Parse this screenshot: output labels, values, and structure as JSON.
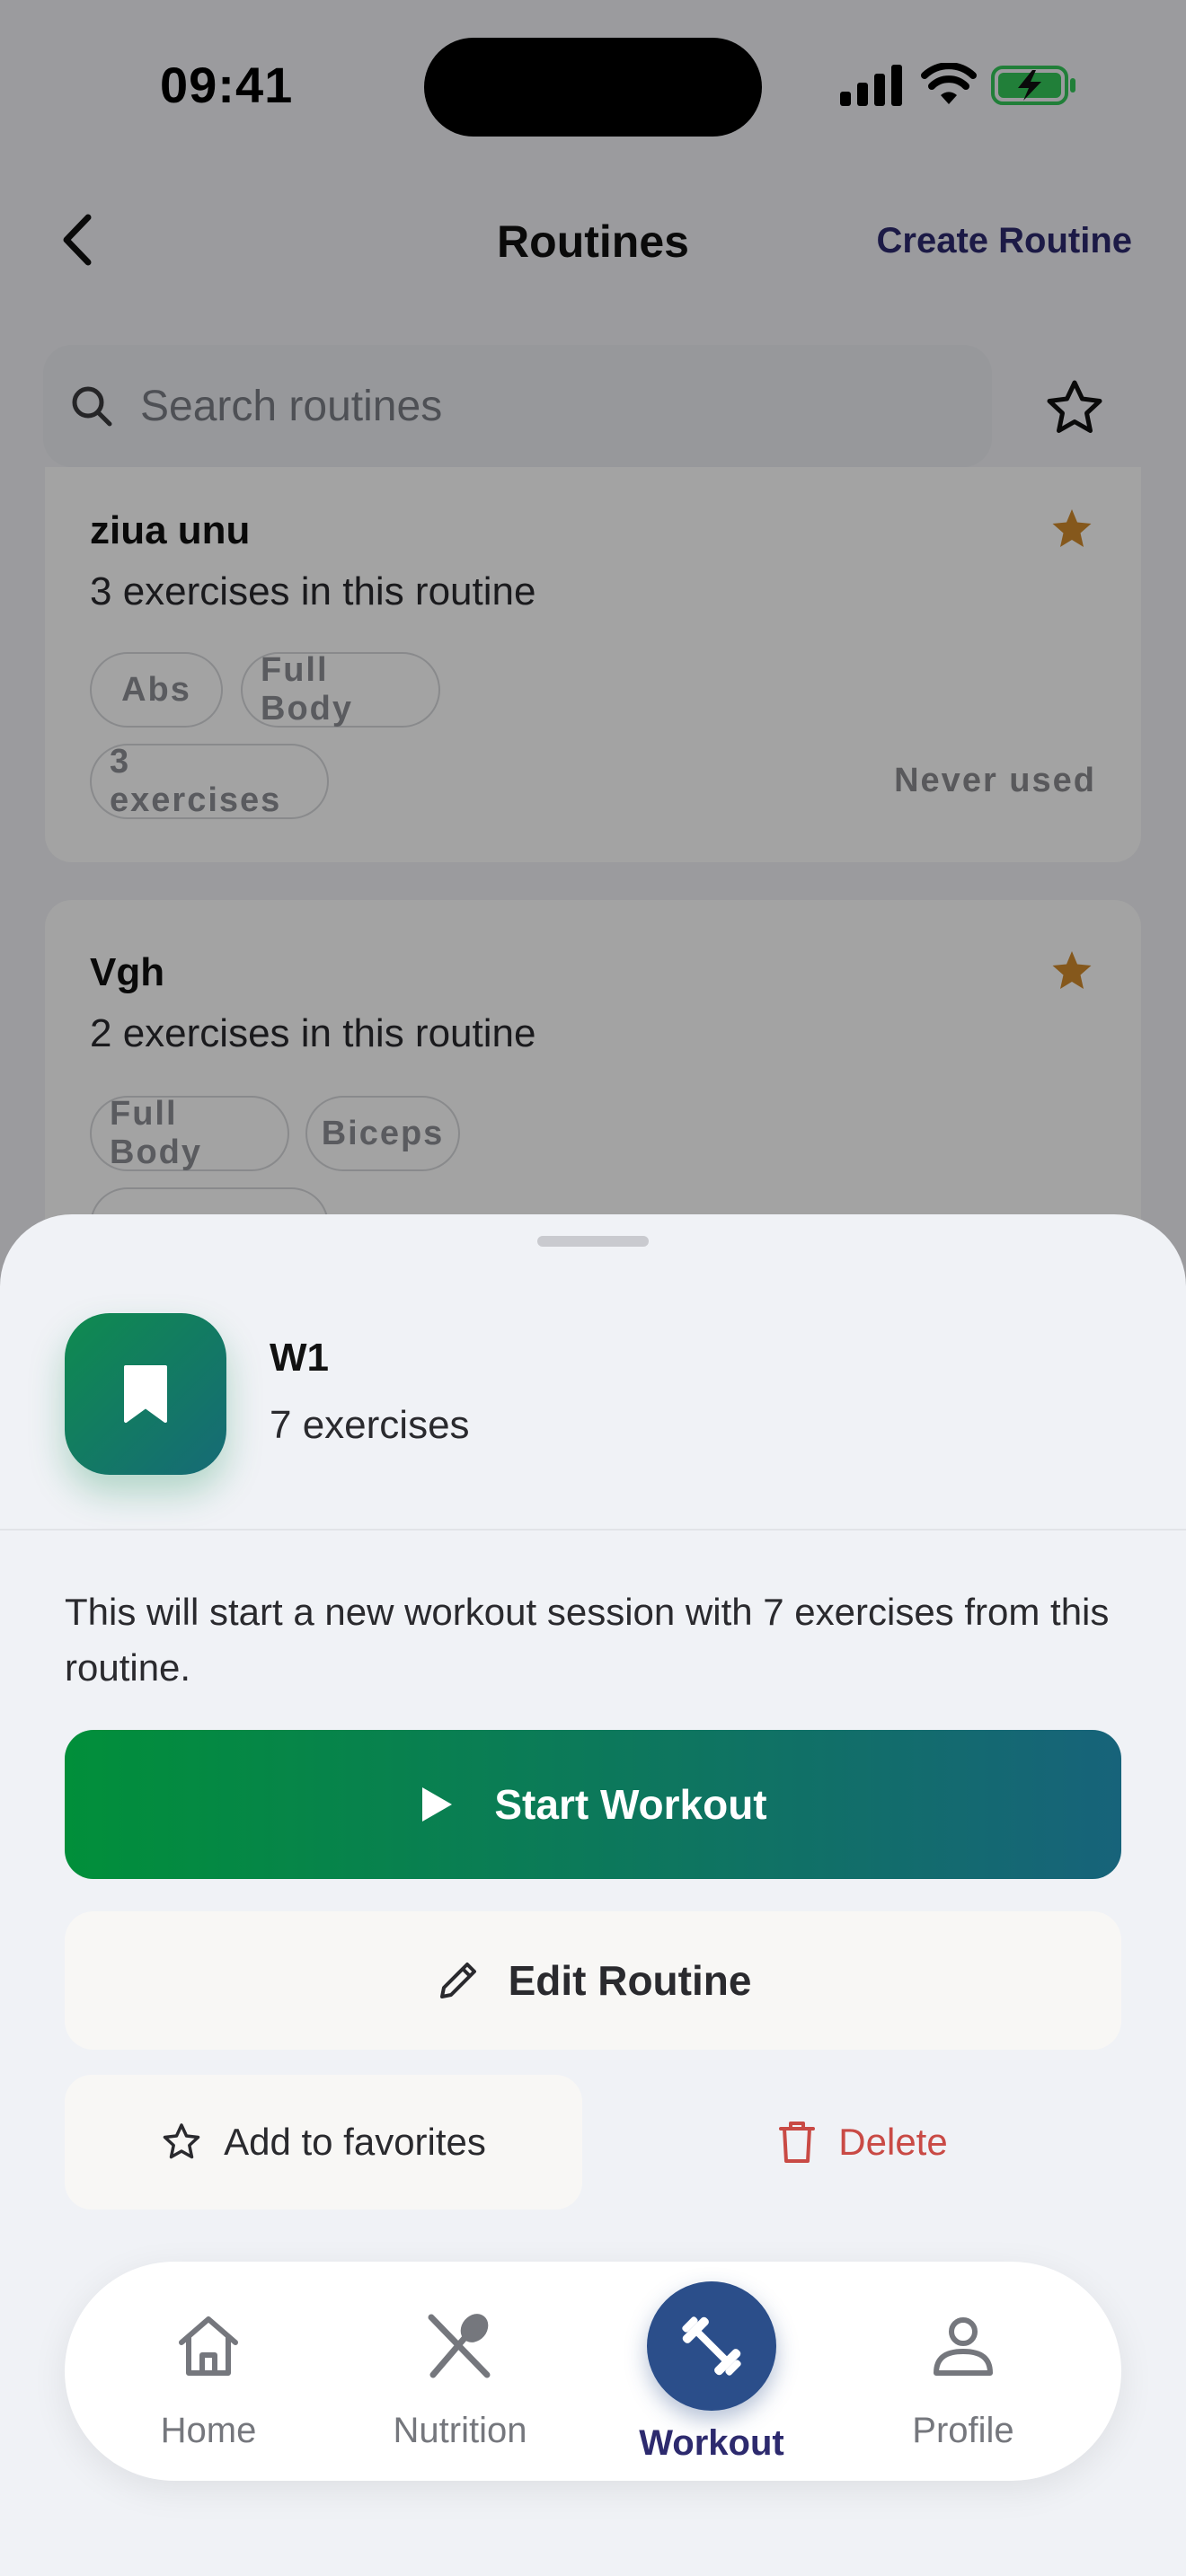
{
  "status_bar": {
    "time": "09:41"
  },
  "header": {
    "title": "Routines",
    "create_label": "Create Routine"
  },
  "search": {
    "placeholder": "Search routines"
  },
  "routines": [
    {
      "name": "ziua unu",
      "subtitle": "3 exercises in this routine",
      "tags": [
        "Abs",
        "Full Body"
      ],
      "count_badge": "3 exercises",
      "last_used": "Never used",
      "favorite": true
    },
    {
      "name": "Vgh",
      "subtitle": "2 exercises in this routine",
      "tags": [
        "Full Body",
        "Biceps"
      ],
      "favorite": true
    }
  ],
  "sheet": {
    "routine_name": "W1",
    "exercise_count": "7 exercises",
    "description": "This will start a new workout session with 7 exercises from this routine.",
    "start_label": "Start Workout",
    "edit_label": "Edit Routine",
    "favorite_label": "Add to favorites",
    "delete_label": "Delete"
  },
  "tabbar": {
    "home": "Home",
    "nutrition": "Nutrition",
    "workout": "Workout",
    "profile": "Profile",
    "active": "workout"
  },
  "colors": {
    "accent_navy": "#2d2a6e",
    "start_gradient_from": "#018f3a",
    "start_gradient_to": "#17637a",
    "delete_red": "#c94a45",
    "star_orange": "#d08a2c",
    "workout_bubble": "#2b4e8a"
  }
}
